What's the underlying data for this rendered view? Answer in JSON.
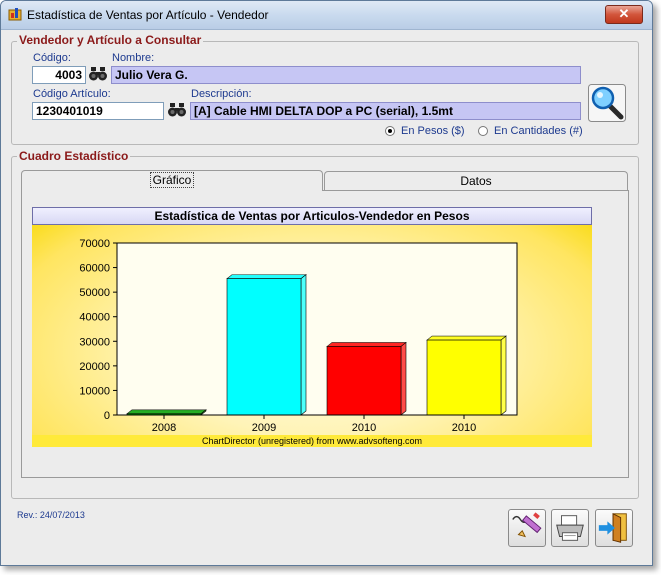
{
  "window": {
    "title": "Estadística de Ventas por Artículo - Vendedor",
    "close_label": "✕"
  },
  "group1": {
    "legend": "Vendedor y Artículo a Consultar",
    "codigo_label": "Código:",
    "codigo_value": "4003",
    "nombre_label": "Nombre:",
    "nombre_value": "Julio Vera G.",
    "codigo_articulo_label": "Código Artículo:",
    "codigo_articulo_value": "1230401019",
    "descripcion_label": "Descripción:",
    "descripcion_value": "[A] Cable HMI DELTA DOP a PC (serial), 1.5mt",
    "radio_pesos_label": "En Pesos ($)",
    "radio_cantidades_label": "En Cantidades (#)",
    "selected_mode": "pesos"
  },
  "group2": {
    "legend": "Cuadro Estadístico",
    "tabs": [
      {
        "label": "Gráfico",
        "active": true
      },
      {
        "label": "Datos",
        "active": false
      }
    ]
  },
  "chart_data": {
    "type": "bar",
    "title": "Estadística de Ventas por Articulos-Vendedor en Pesos",
    "categories": [
      "2008",
      "2009",
      "2010",
      "2010"
    ],
    "values": [
      500,
      55500,
      27900,
      30500
    ],
    "colors": [
      "#00a000",
      "#00ffff",
      "#ff0000",
      "#ffff00"
    ],
    "ylim": [
      0,
      70000
    ],
    "yticks": [
      "0",
      "10000",
      "20000",
      "30000",
      "40000",
      "50000",
      "60000",
      "70000"
    ],
    "xlabel": "",
    "ylabel": "",
    "grid": false,
    "footer": "ChartDirector (unregistered) from www.advsofteng.com"
  },
  "footer": {
    "revision": "Rev.: 24/07/2013"
  },
  "icons": {
    "search": "magnifier-icon",
    "binoculars": "binoculars-icon",
    "edit": "pencil-pad-icon",
    "print": "printer-icon",
    "exit": "exit-door-icon"
  }
}
